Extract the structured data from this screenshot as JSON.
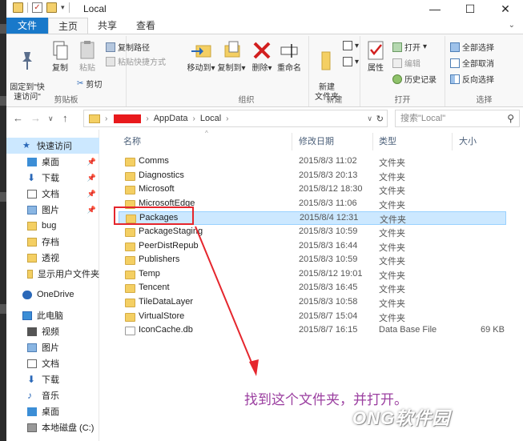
{
  "window": {
    "title": "Local",
    "controls": [
      "—",
      "☐",
      "✕"
    ]
  },
  "ribbon_tabs": [
    "文件",
    "主页",
    "共享",
    "查看"
  ],
  "ribbon": {
    "clipboard": {
      "label": "剪贴板",
      "pin": "固定到\"快\n速访问\"",
      "copy": "复制",
      "paste": "粘贴",
      "copy_path": "复制路径",
      "paste_shortcut": "粘贴快捷方式",
      "cut": "剪切"
    },
    "organize": {
      "label": "组织",
      "move_to": "移动到",
      "copy_to": "复制到",
      "delete": "删除",
      "rename": "重命名"
    },
    "new": {
      "label": "新建",
      "new_folder": "新建\n文件夹"
    },
    "open": {
      "label": "打开",
      "properties": "属性",
      "open": "打开",
      "edit": "编辑",
      "history": "历史记录"
    },
    "select": {
      "label": "选择",
      "select_all": "全部选择",
      "select_none": "全部取消",
      "invert": "反向选择"
    }
  },
  "address": {
    "crumbs": [
      "AppData",
      "Local"
    ],
    "search_placeholder": "搜索\"Local\""
  },
  "sidebar": {
    "items": [
      {
        "label": "快速访问",
        "icon": "star-icon",
        "pinned": false
      },
      {
        "label": "桌面",
        "icon": "desktop-icon",
        "pinned": true
      },
      {
        "label": "下载",
        "icon": "download-icon",
        "pinned": true
      },
      {
        "label": "文档",
        "icon": "document-icon",
        "pinned": true
      },
      {
        "label": "图片",
        "icon": "picture-icon",
        "pinned": true
      },
      {
        "label": "bug",
        "icon": "folder-icon",
        "pinned": false
      },
      {
        "label": "存档",
        "icon": "folder-icon",
        "pinned": false
      },
      {
        "label": "透视",
        "icon": "folder-icon",
        "pinned": false
      },
      {
        "label": "显示用户文件夹",
        "icon": "folder-icon",
        "pinned": false
      },
      {
        "label": "OneDrive",
        "icon": "cloud-icon",
        "pinned": false
      },
      {
        "label": "此电脑",
        "icon": "computer-icon",
        "pinned": false
      },
      {
        "label": "视频",
        "icon": "video-icon",
        "pinned": false
      },
      {
        "label": "图片",
        "icon": "picture-icon",
        "pinned": false
      },
      {
        "label": "文档",
        "icon": "document-icon",
        "pinned": false
      },
      {
        "label": "下载",
        "icon": "download-icon",
        "pinned": false
      },
      {
        "label": "音乐",
        "icon": "music-icon",
        "pinned": false
      },
      {
        "label": "桌面",
        "icon": "desktop-icon",
        "pinned": false
      },
      {
        "label": "本地磁盘 (C:)",
        "icon": "drive-icon",
        "pinned": false
      }
    ]
  },
  "columns": [
    "名称",
    "修改日期",
    "类型",
    "大小"
  ],
  "files": [
    {
      "name": "Comms",
      "date": "2015/8/3 11:02",
      "type": "文件夹",
      "size": ""
    },
    {
      "name": "Diagnostics",
      "date": "2015/8/3 20:13",
      "type": "文件夹",
      "size": ""
    },
    {
      "name": "Microsoft",
      "date": "2015/8/12 18:30",
      "type": "文件夹",
      "size": ""
    },
    {
      "name": "MicrosoftEdge",
      "date": "2015/8/3 11:06",
      "type": "文件夹",
      "size": ""
    },
    {
      "name": "Packages",
      "date": "2015/8/4 12:31",
      "type": "文件夹",
      "size": ""
    },
    {
      "name": "PackageStaging",
      "date": "2015/8/3 10:59",
      "type": "文件夹",
      "size": ""
    },
    {
      "name": "PeerDistRepub",
      "date": "2015/8/3 16:44",
      "type": "文件夹",
      "size": ""
    },
    {
      "name": "Publishers",
      "date": "2015/8/3 10:59",
      "type": "文件夹",
      "size": ""
    },
    {
      "name": "Temp",
      "date": "2015/8/12 19:01",
      "type": "文件夹",
      "size": ""
    },
    {
      "name": "Tencent",
      "date": "2015/8/3 16:45",
      "type": "文件夹",
      "size": ""
    },
    {
      "name": "TileDataLayer",
      "date": "2015/8/3 10:58",
      "type": "文件夹",
      "size": ""
    },
    {
      "name": "VirtualStore",
      "date": "2015/8/7 15:04",
      "type": "文件夹",
      "size": ""
    },
    {
      "name": "IconCache.db",
      "date": "2015/8/7 16:15",
      "type": "Data Base File",
      "size": "69 KB"
    }
  ],
  "annotation": "找到这个文件夹，并打开。",
  "watermark": "ONG软件园",
  "colors": {
    "file_tab": "#1979ca",
    "selection": "#cce8ff",
    "highlight_box": "#e5262d",
    "annotation": "#9b3fa0"
  }
}
